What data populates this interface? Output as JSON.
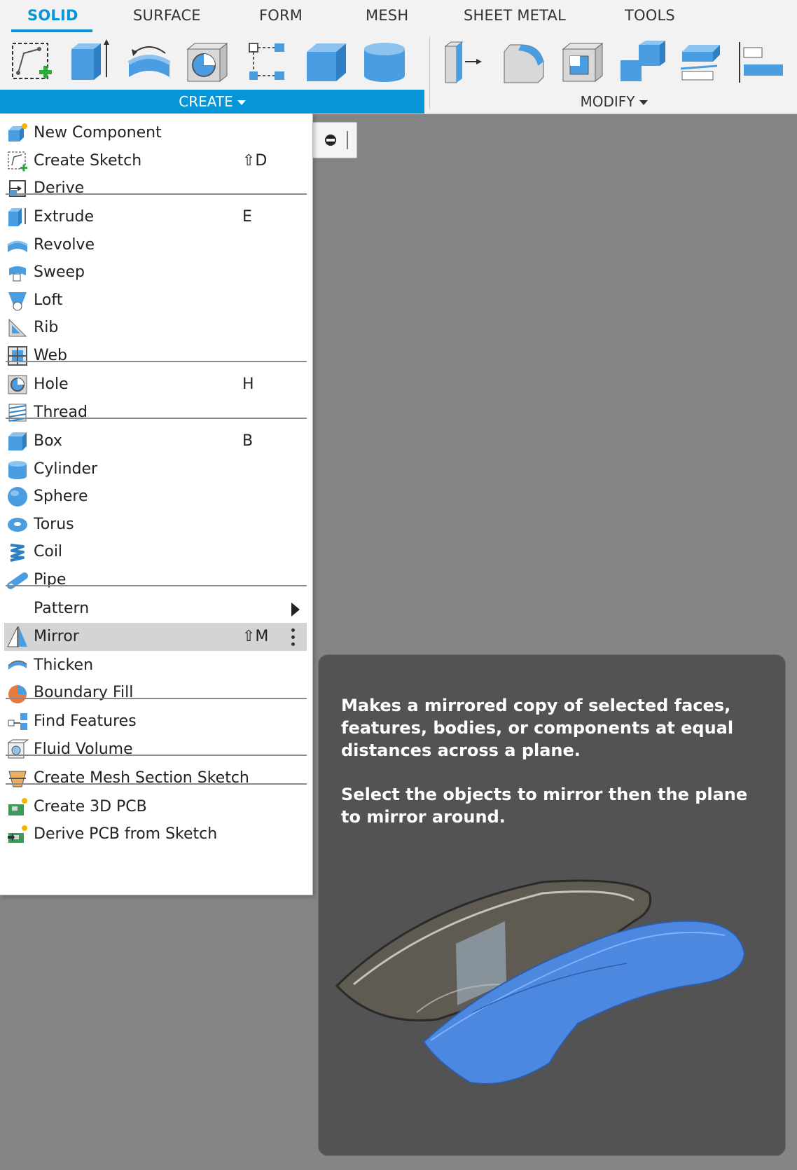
{
  "toolbar": {
    "tabs": [
      "SOLID",
      "SURFACE",
      "FORM",
      "MESH",
      "SHEET METAL",
      "TOOLS"
    ],
    "active_tab": "SOLID",
    "groups": {
      "create": "CREATE",
      "modify": "MODIFY"
    },
    "create_tools": [
      "create-sketch-icon",
      "extrude-icon",
      "revolve-icon",
      "hole-icon",
      "pattern-icon",
      "box-icon",
      "cylinder-icon"
    ],
    "modify_tools": [
      "press-pull-icon",
      "fillet-icon",
      "shell-icon",
      "combine-icon",
      "offset-face-icon",
      "align-icon"
    ]
  },
  "menu": {
    "items": [
      {
        "label": "New Component",
        "shortcut": "",
        "icon": "new-component-icon"
      },
      {
        "label": "Create Sketch",
        "shortcut": "⇧D",
        "icon": "create-sketch-icon"
      },
      {
        "label": "Derive",
        "shortcut": "",
        "icon": "derive-icon"
      },
      {
        "label": "Extrude",
        "shortcut": "E",
        "icon": "extrude-icon"
      },
      {
        "label": "Revolve",
        "shortcut": "",
        "icon": "revolve-icon"
      },
      {
        "label": "Sweep",
        "shortcut": "",
        "icon": "sweep-icon"
      },
      {
        "label": "Loft",
        "shortcut": "",
        "icon": "loft-icon"
      },
      {
        "label": "Rib",
        "shortcut": "",
        "icon": "rib-icon"
      },
      {
        "label": "Web",
        "shortcut": "",
        "icon": "web-icon"
      },
      {
        "label": "Hole",
        "shortcut": "H",
        "icon": "hole-icon"
      },
      {
        "label": "Thread",
        "shortcut": "",
        "icon": "thread-icon"
      },
      {
        "label": "Box",
        "shortcut": "B",
        "icon": "box-icon"
      },
      {
        "label": "Cylinder",
        "shortcut": "",
        "icon": "cylinder-icon"
      },
      {
        "label": "Sphere",
        "shortcut": "",
        "icon": "sphere-icon"
      },
      {
        "label": "Torus",
        "shortcut": "",
        "icon": "torus-icon"
      },
      {
        "label": "Coil",
        "shortcut": "",
        "icon": "coil-icon"
      },
      {
        "label": "Pipe",
        "shortcut": "",
        "icon": "pipe-icon"
      },
      {
        "label": "Pattern",
        "shortcut": "",
        "icon": "",
        "submenu": true
      },
      {
        "label": "Mirror",
        "shortcut": "⇧M",
        "icon": "mirror-icon",
        "highlighted": true
      },
      {
        "label": "Thicken",
        "shortcut": "",
        "icon": "thicken-icon"
      },
      {
        "label": "Boundary Fill",
        "shortcut": "",
        "icon": "boundary-fill-icon"
      },
      {
        "label": "Find Features",
        "shortcut": "",
        "icon": "find-features-icon"
      },
      {
        "label": "Fluid Volume",
        "shortcut": "",
        "icon": "fluid-volume-icon"
      },
      {
        "label": "Create Mesh Section Sketch",
        "shortcut": "",
        "icon": "mesh-section-sketch-icon"
      },
      {
        "label": "Create 3D PCB",
        "shortcut": "",
        "icon": "pcb-3d-icon"
      },
      {
        "label": "Derive PCB from Sketch",
        "shortcut": "",
        "icon": "derive-pcb-icon"
      }
    ]
  },
  "tooltip": {
    "description": "Makes a mirrored copy of selected faces, features, bodies, or components at equal distances across a plane.",
    "instructions": "Select the objects to mirror then the plane to mirror around."
  },
  "colors": {
    "accent": "#0696d7",
    "icon_blue": "#4a9de0",
    "highlight": "#d4d4d4",
    "canvas": "#858585",
    "tooltip_bg": "#535353"
  }
}
